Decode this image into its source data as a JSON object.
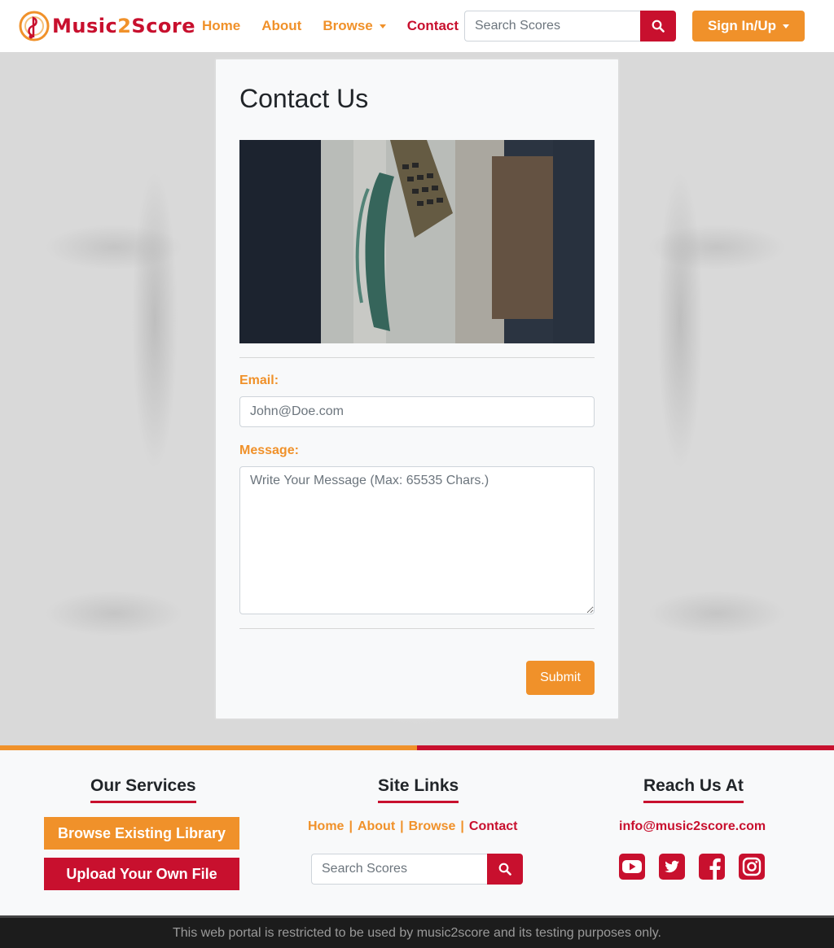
{
  "brand": {
    "name_part1": "Music",
    "name_part2": "2",
    "name_part3": "Score"
  },
  "nav": {
    "items": [
      {
        "label": "Home",
        "active": false
      },
      {
        "label": "About",
        "active": false
      },
      {
        "label": "Browse",
        "active": false,
        "dropdown": true
      },
      {
        "label": "Contact",
        "active": true
      }
    ],
    "search_placeholder": "Search Scores",
    "signin_label": "Sign In/Up"
  },
  "contact": {
    "title": "Contact Us",
    "email_label": "Email:",
    "email_placeholder": "John@Doe.com",
    "message_label": "Message:",
    "message_placeholder": "Write Your Message (Max: 65535 Chars.)",
    "submit_label": "Submit"
  },
  "footer": {
    "services": {
      "heading": "Our Services",
      "browse_label": "Browse Existing Library",
      "upload_label": "Upload Your Own File"
    },
    "site_links": {
      "heading": "Site Links",
      "links": [
        "Home",
        "About",
        "Browse",
        "Contact"
      ],
      "separator": "|",
      "search_placeholder": "Search Scores"
    },
    "reach": {
      "heading": "Reach Us At",
      "email": "info@music2score.com",
      "social_icons": [
        "youtube-icon",
        "twitter-icon",
        "facebook-icon",
        "instagram-icon"
      ]
    }
  },
  "bottom_notice": "This web portal is restricted to be used by music2score and its testing purposes only.",
  "colors": {
    "primary_orange": "#f0912a",
    "primary_red": "#c8102e",
    "dark": "#1c1c1c"
  }
}
